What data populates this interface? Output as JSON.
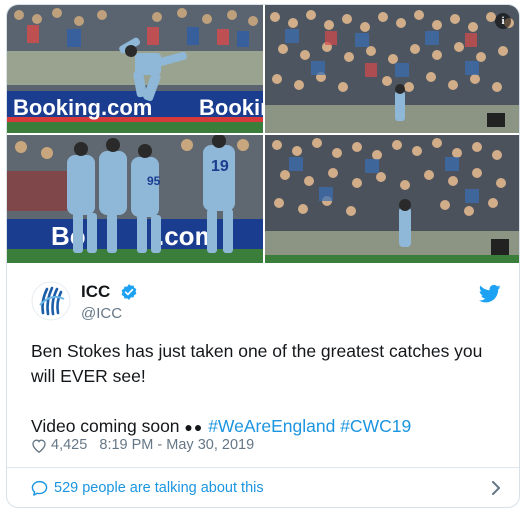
{
  "media": {
    "info_icon": "info-icon",
    "sponsor_text_1": "Booking.com",
    "sponsor_text_2": "Bookin",
    "sponsor_text_3": "Bo",
    "sponsor_text_4": ".com",
    "jersey_number_1": "19",
    "jersey_number_2": "95"
  },
  "tweet": {
    "author_name": "ICC",
    "author_handle": "@ICC",
    "verified_icon": "verified-badge-icon",
    "bird_icon": "twitter-bird-icon",
    "text_line_1": "Ben Stokes has just taken one of the greatest catches you will EVER see!",
    "text_line_2_prefix": "Video coming soon",
    "text_emoji": "●●",
    "hashtag_1": "#WeAreEngland",
    "hashtag_2": "#CWC19",
    "likes": "4,425",
    "timestamp": "8:19 PM - May 30, 2019",
    "conversation": "529 people are talking about this"
  },
  "colors": {
    "link": "#1b95e0",
    "text": "#14171a",
    "muted": "#657786",
    "jersey": "#8fb8d8",
    "grass": "#3b7d3a",
    "banner": "#1a3d8f"
  }
}
